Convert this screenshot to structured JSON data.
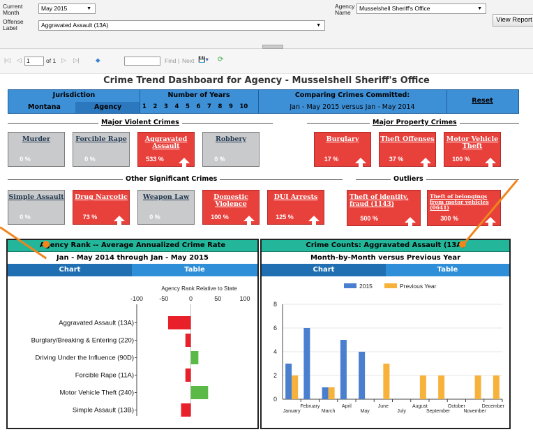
{
  "params": {
    "current_month_label": "Current\nMonth",
    "current_month_value": "May 2015",
    "agency_label": "Agency\nName",
    "agency_value": "Musselshell Sheriff's Office",
    "offense_label": "Offense\nLabel",
    "offense_value": "Aggravated Assault (13A)",
    "view_report": "View Report"
  },
  "toolbar": {
    "first": "|◁",
    "prev": "◁",
    "page_value": "1",
    "of_pages": "of 1",
    "next": "▷",
    "last": "▷|",
    "back": "◆",
    "find": "Find",
    "divider": "|",
    "next_find": "Next",
    "export": "💾▾",
    "refresh": "⟳"
  },
  "title": "Crime Trend Dashboard for Agency - Musselshell Sheriff's Office",
  "header": {
    "jurisdiction": "Jurisdiction",
    "montana": "Montana",
    "agency": "Agency",
    "number_of_years": "Number of Years",
    "years": [
      "1",
      "2",
      "3",
      "4",
      "5",
      "6",
      "7",
      "8",
      "9",
      "10"
    ],
    "comparing": "Comparing Crimes Committed:",
    "period": "Jan - May 2015  versus  Jan - May 2014",
    "reset": "Reset"
  },
  "sections": {
    "violent": "Major Violent Crimes",
    "property": "Major Property Crimes",
    "other": "Other Significant Crimes",
    "outliers": "Outliers"
  },
  "tiles": [
    {
      "name": "Murder",
      "value": "0 %",
      "color": "gray",
      "up": false
    },
    {
      "name": "Forcible Rape",
      "value": "0 %",
      "color": "gray",
      "up": false
    },
    {
      "name": "Aggravated Assault",
      "value": "533 %",
      "color": "red",
      "up": true
    },
    {
      "name": "Robbery",
      "value": "0 %",
      "color": "gray",
      "up": false
    },
    {
      "name": "Burglary",
      "value": "17 %",
      "color": "red",
      "up": true
    },
    {
      "name": "Theft Offenses",
      "value": "37 %",
      "color": "red",
      "up": true
    },
    {
      "name": "Motor Vehicle Theft",
      "value": "100 %",
      "color": "red",
      "up": true
    },
    {
      "name": "Simple Assault",
      "value": "0 %",
      "color": "gray",
      "up": false
    },
    {
      "name": "Drug Narcotic",
      "value": "73 %",
      "color": "red",
      "up": true
    },
    {
      "name": "Weapon Law",
      "value": "0 %",
      "color": "gray",
      "up": false
    },
    {
      "name": "Domestic Violence",
      "value": "100 %",
      "color": "red",
      "up": true
    },
    {
      "name": "DUI Arrests",
      "value": "125 %",
      "color": "red",
      "up": true
    },
    {
      "name": "Theft of identity, fraud (1143)",
      "value": "500 %",
      "color": "red",
      "up": true
    },
    {
      "name": "Theft of belongings from motor vehicles (0641)",
      "value": "300 %",
      "color": "red",
      "up": true
    }
  ],
  "left_panel": {
    "title": "Agency Rank -- Average Annualized Crime Rate",
    "subtitle": "Jan - May 2014  through  Jan - May 2015",
    "tab_chart": "Chart",
    "tab_table": "Table"
  },
  "right_panel": {
    "title": "Crime Counts: Aggravated Assault (13A)",
    "subtitle": "Month-by-Month versus Previous Year",
    "tab_chart": "Chart",
    "tab_table": "Table"
  },
  "colors": {
    "header_blue": "#3d8fd6",
    "tile_red": "#e8413c",
    "tile_gray": "#c9cacc",
    "panel_teal": "#23b69a",
    "bar_red": "#e8202a",
    "bar_green": "#5ab947",
    "series_2015": "#4a7fcf",
    "series_prev": "#f7b23b",
    "callout_orange": "#f0851c"
  },
  "chart_data": [
    {
      "type": "bar",
      "orientation": "horizontal",
      "title": "Agency Rank Relative to State",
      "categories": [
        "Aggravated Assault (13A)",
        "Burglary/Breaking & Entering (220)",
        "Driving Under the Influence (90D)",
        "Forcible Rape (11A)",
        "Motor Vehicle Theft (240)",
        "Simple Assault (13B)"
      ],
      "values": [
        -42,
        -10,
        14,
        -10,
        32,
        -18
      ],
      "xlim": [
        -100,
        100
      ],
      "xticks": [
        "-100",
        "-50",
        "0",
        "50",
        "100"
      ],
      "colors_rule": "negative red, positive green"
    },
    {
      "type": "bar",
      "categories": [
        "January",
        "February",
        "March",
        "April",
        "May",
        "June",
        "July",
        "August",
        "September",
        "October",
        "November",
        "December"
      ],
      "series": [
        {
          "name": "2015",
          "values": [
            3,
            6,
            1,
            5,
            4,
            0,
            0,
            0,
            0,
            0,
            0,
            0
          ]
        },
        {
          "name": "Previous Year",
          "values": [
            2,
            0,
            1,
            0,
            0,
            3,
            0,
            2,
            2,
            0,
            2,
            2
          ]
        }
      ],
      "yticks": [
        "0",
        "2",
        "4",
        "6",
        "8"
      ],
      "ylim": [
        0,
        8
      ],
      "legend": "top"
    }
  ]
}
